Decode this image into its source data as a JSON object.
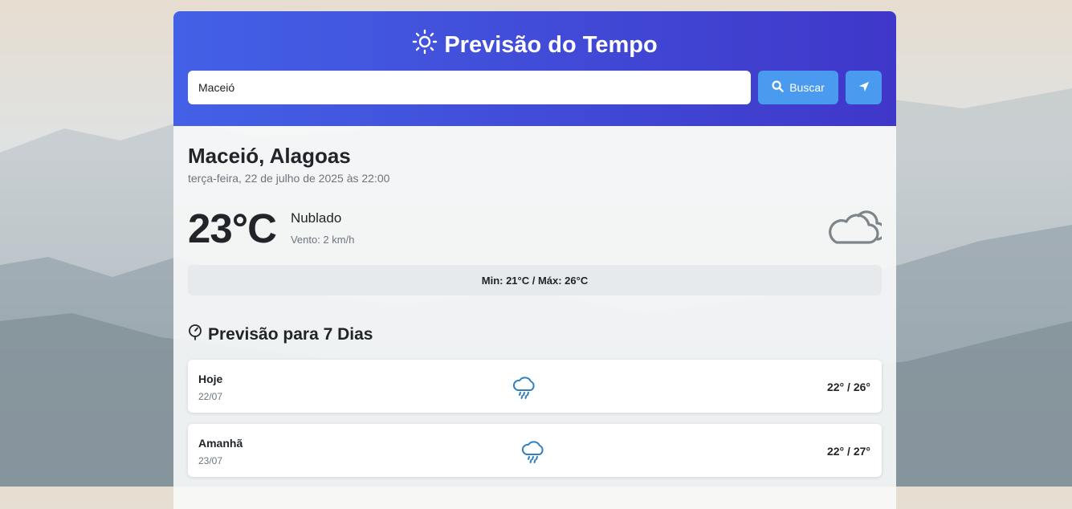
{
  "header": {
    "title": "Previsão do Tempo",
    "title_icon": "sun-icon"
  },
  "search": {
    "value": "Maceió",
    "placeholder": "",
    "button_label": "Buscar",
    "button_icon": "search-icon",
    "location_icon": "location-arrow-icon"
  },
  "current": {
    "city": "Maceió, Alagoas",
    "datetime": "terça-feira, 22 de julho de 2025 às 22:00",
    "temperature": "23°C",
    "condition": "Nublado",
    "wind": "Vento: 2 km/h",
    "icon": "cloud-icon",
    "minmax": "Min: 21°C / Máx: 26°C"
  },
  "forecast": {
    "title": "Previsão para 7 Dias",
    "title_icon": "thermometer-gauge-icon",
    "days": [
      {
        "name": "Hoje",
        "date": "22/07",
        "icon": "rain-cloud-icon",
        "temps": "22° / 26°"
      },
      {
        "name": "Amanhã",
        "date": "23/07",
        "icon": "rain-cloud-icon",
        "temps": "22° / 27°"
      }
    ]
  },
  "colors": {
    "header_start": "#4361e6",
    "header_end": "#3f37c9",
    "button": "#4a9bf0",
    "rain_icon": "#2f7fc1",
    "cloud_icon": "#7d8589"
  }
}
